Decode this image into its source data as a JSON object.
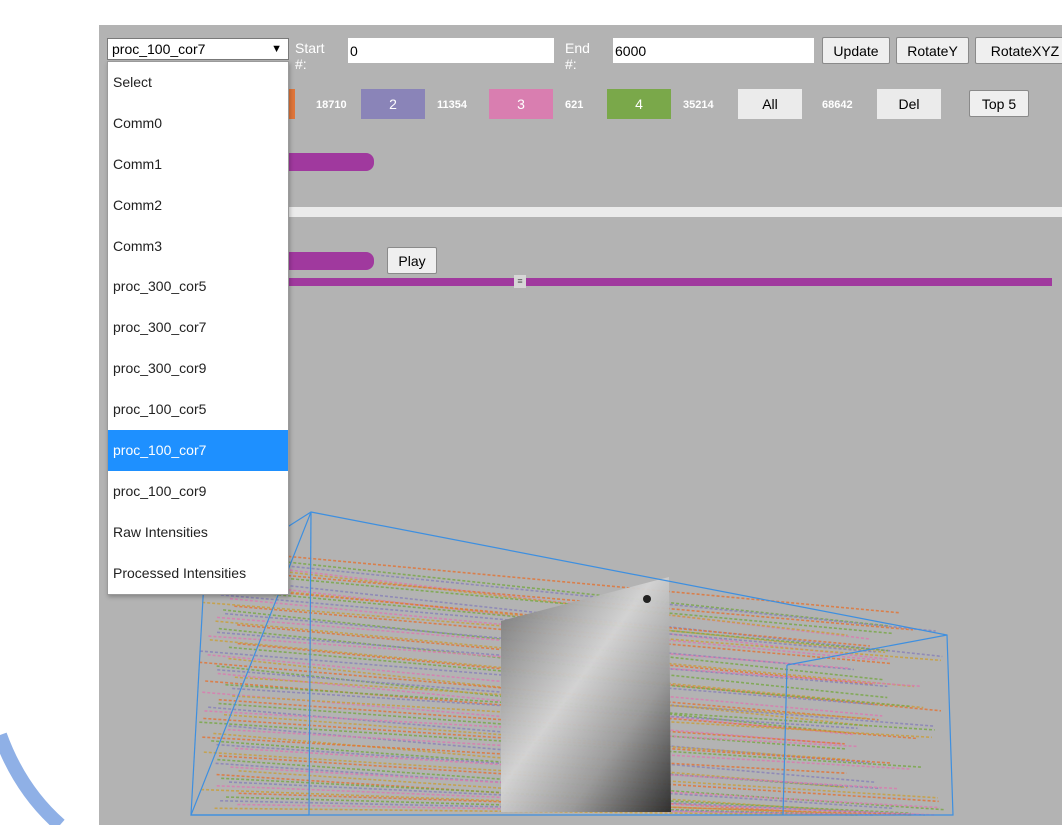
{
  "controls": {
    "dataset_select_value": "proc_100_cor7",
    "start_label": "Start #:",
    "start_value": "0",
    "end_label": "End #:",
    "end_value": "6000",
    "update_label": "Update",
    "rotate_y_label": "RotateY",
    "rotate_xyz_label": "RotateXYZ",
    "play_label": "Play",
    "slider_handle_glyph": "≡"
  },
  "legend": {
    "items": [
      {
        "label": "",
        "count": "18710",
        "color": "#e0763a"
      },
      {
        "label": "2",
        "count": "11354",
        "color": "#8a84b8"
      },
      {
        "label": "3",
        "count": "621",
        "color": "#d97eb0"
      },
      {
        "label": "4",
        "count": "35214",
        "color": "#7aa84a"
      }
    ],
    "all_label": "All",
    "all_count": "68642",
    "del_label": "Del",
    "top5_label": "Top 5"
  },
  "dropdown": {
    "options": [
      "Select",
      "Comm0",
      "Comm1",
      "Comm2",
      "Comm3",
      "proc_300_cor5",
      "proc_300_cor7",
      "proc_300_cor9",
      "proc_100_cor5",
      "proc_100_cor7",
      "proc_100_cor9",
      "Raw Intensities",
      "Processed Intensities"
    ],
    "selected_index": 9
  },
  "colors": {
    "panel_bg": "#b3b3b3",
    "accent_purple": "#a0399e",
    "selection_blue": "#1e90ff",
    "box_outline": "#3d8fe0",
    "decor_arc": "#8fb0e6"
  }
}
